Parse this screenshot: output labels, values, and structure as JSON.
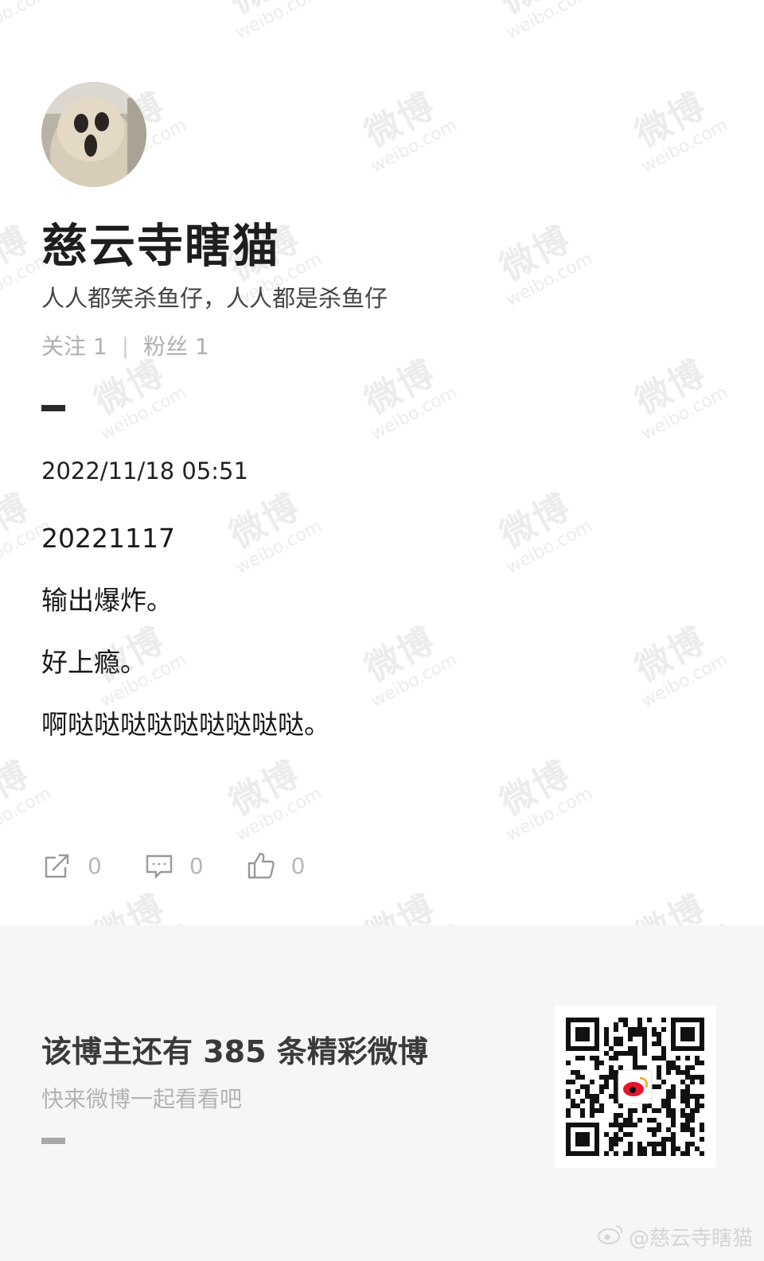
{
  "watermark": {
    "cn": "微博",
    "en": "weibo.com"
  },
  "profile": {
    "name": "慈云寺瞎猫",
    "bio": "人人都笑杀鱼仔，人人都是杀鱼仔",
    "following_label": "关注 1",
    "followers_label": "粉丝 1",
    "separator": "|"
  },
  "post": {
    "datetime": "2022/11/18 05:51",
    "lines": [
      "20221117",
      "输出爆炸。",
      "好上瘾。",
      "啊哒哒哒哒哒哒哒哒哒。"
    ]
  },
  "actions": {
    "repost_count": "0",
    "comment_count": "0",
    "like_count": "0"
  },
  "footer": {
    "title": "该博主还有 385 条精彩微博",
    "subtitle": "快来微博一起看看吧"
  },
  "credit": "@慈云寺瞎猫",
  "colors": {
    "accent": "#e6162d",
    "muted": "#b0b0b0",
    "footer_bg": "#f6f6f6"
  },
  "icons": [
    "repost-icon",
    "comment-icon",
    "like-icon",
    "weibo-logo-icon"
  ]
}
